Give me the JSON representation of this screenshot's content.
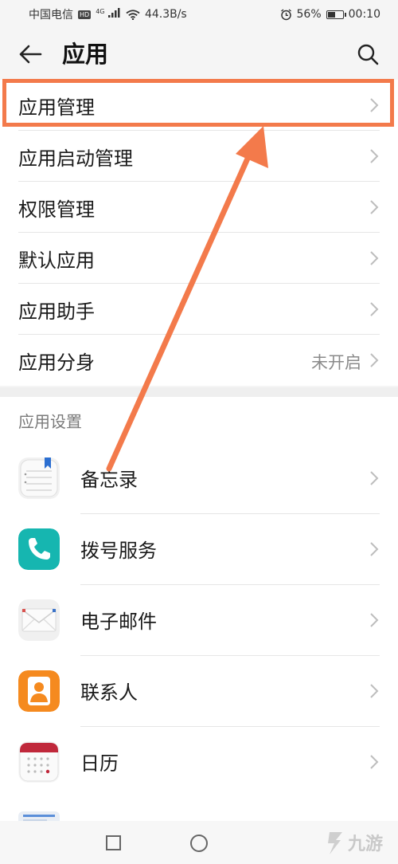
{
  "status_bar": {
    "carrier": "中国电信",
    "hd": "HD",
    "network": "4G",
    "speed": "44.3B/s",
    "battery": "56%",
    "battery_level": 0.56,
    "time": "00:10"
  },
  "header": {
    "title": "应用"
  },
  "top_list": [
    {
      "label": "应用管理",
      "value": ""
    },
    {
      "label": "应用启动管理",
      "value": ""
    },
    {
      "label": "权限管理",
      "value": ""
    },
    {
      "label": "默认应用",
      "value": ""
    },
    {
      "label": "应用助手",
      "value": ""
    },
    {
      "label": "应用分身",
      "value": "未开启"
    }
  ],
  "section": {
    "title": "应用设置"
  },
  "app_list": [
    {
      "label": "备忘录",
      "icon": "notepad-icon"
    },
    {
      "label": "拨号服务",
      "icon": "phone-icon"
    },
    {
      "label": "电子邮件",
      "icon": "email-icon"
    },
    {
      "label": "联系人",
      "icon": "contacts-icon"
    },
    {
      "label": "日历",
      "icon": "calendar-icon"
    }
  ],
  "watermark": {
    "text": "九游"
  },
  "colors": {
    "accent_annotation": "#f37a4b",
    "phone": "#16b6b0",
    "contacts": "#f58a1f",
    "calendar": "#c0283b"
  }
}
